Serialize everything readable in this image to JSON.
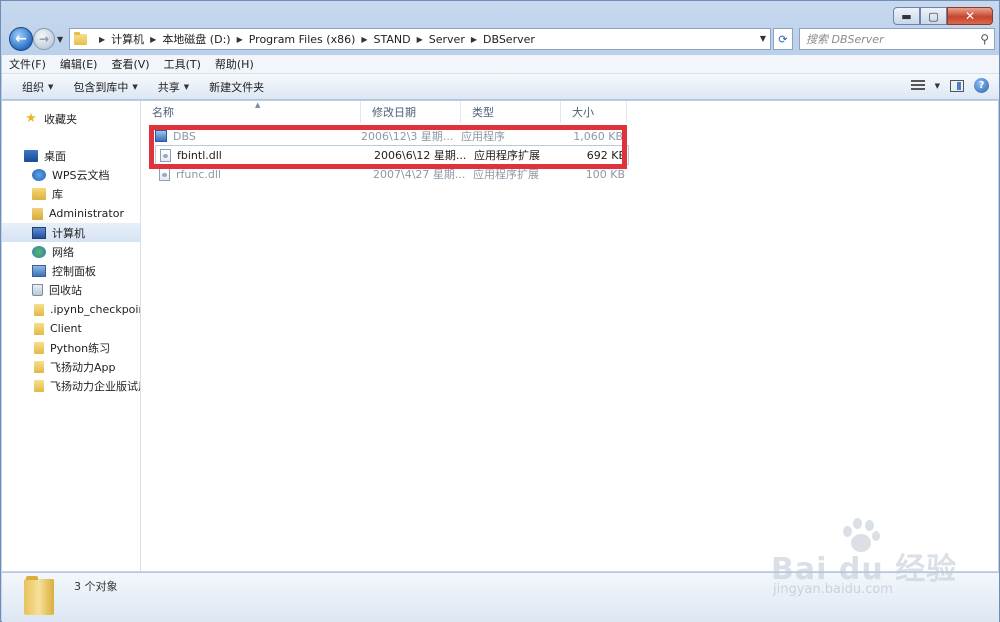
{
  "window": {
    "controls": {
      "minimize": "▬",
      "maximize": "▢",
      "close": "✕"
    }
  },
  "nav": {
    "back_icon": "←",
    "forward_icon": "→",
    "breadcrumbs": [
      "计算机",
      "本地磁盘 (D:)",
      "Program Files (x86)",
      "STAND",
      "Server",
      "DBServer"
    ],
    "refresh_icon": "⟳",
    "search_placeholder": "搜索 DBServer",
    "search_icon": "⚲"
  },
  "menubar": [
    "文件(F)",
    "编辑(E)",
    "查看(V)",
    "工具(T)",
    "帮助(H)"
  ],
  "toolbar": {
    "organize": "组织",
    "include_library": "包含到库中",
    "share": "共享",
    "new_folder": "新建文件夹",
    "help_icon": "?"
  },
  "navpane": {
    "favorites": "收藏夹",
    "desktop": "桌面",
    "items": [
      "WPS云文档",
      "库",
      "Administrator",
      "计算机",
      "网络",
      "控制面板",
      "回收站",
      ".ipynb_checkpoints",
      "Client",
      "Python练习",
      "飞扬动力App",
      "飞扬动力企业版试用"
    ]
  },
  "columns": [
    "名称",
    "修改日期",
    "类型",
    "大小"
  ],
  "files": [
    {
      "name": "DBS",
      "date": "2006\\12\\3 星期...",
      "type": "应用程序",
      "size": "1,060 KB"
    },
    {
      "name": "fbintl.dll",
      "date": "2006\\6\\12 星期...",
      "type": "应用程序扩展",
      "size": "692 KB"
    },
    {
      "name": "rfunc.dll",
      "date": "2007\\4\\27 星期...",
      "type": "应用程序扩展",
      "size": "100 KB"
    }
  ],
  "status": {
    "count": "3 个对象"
  },
  "watermark": {
    "brand": "Bai du 经验",
    "url": "jingyan.baidu.com"
  },
  "colors": {
    "highlight": "#e0323a",
    "accent": "#2b6fc4"
  }
}
